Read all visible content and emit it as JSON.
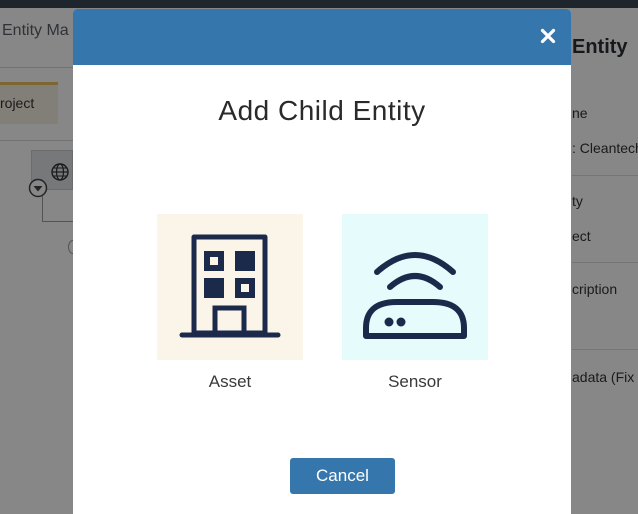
{
  "background": {
    "page_title": "Entity Ma",
    "tab_label": "roject",
    "panel_title": "Entity",
    "panel_fields": [
      {
        "label": "ne",
        "value": ": Cleantech"
      },
      {
        "label": "ty",
        "value": "ect"
      },
      {
        "label": "cription",
        "value": ""
      },
      {
        "label": "adata (Fix",
        "value": ""
      }
    ]
  },
  "modal": {
    "title": "Add Child Entity",
    "close_glyph": "×",
    "options": [
      {
        "label": "Asset",
        "icon": "building-icon",
        "bg_color": "#fbf4e8"
      },
      {
        "label": "Sensor",
        "icon": "sensor-icon",
        "bg_color": "#e6fbfc"
      }
    ],
    "cancel_label": "Cancel"
  },
  "colors": {
    "header": "#3577ad",
    "button": "#3577ad",
    "icon": "#1b2a4a"
  }
}
